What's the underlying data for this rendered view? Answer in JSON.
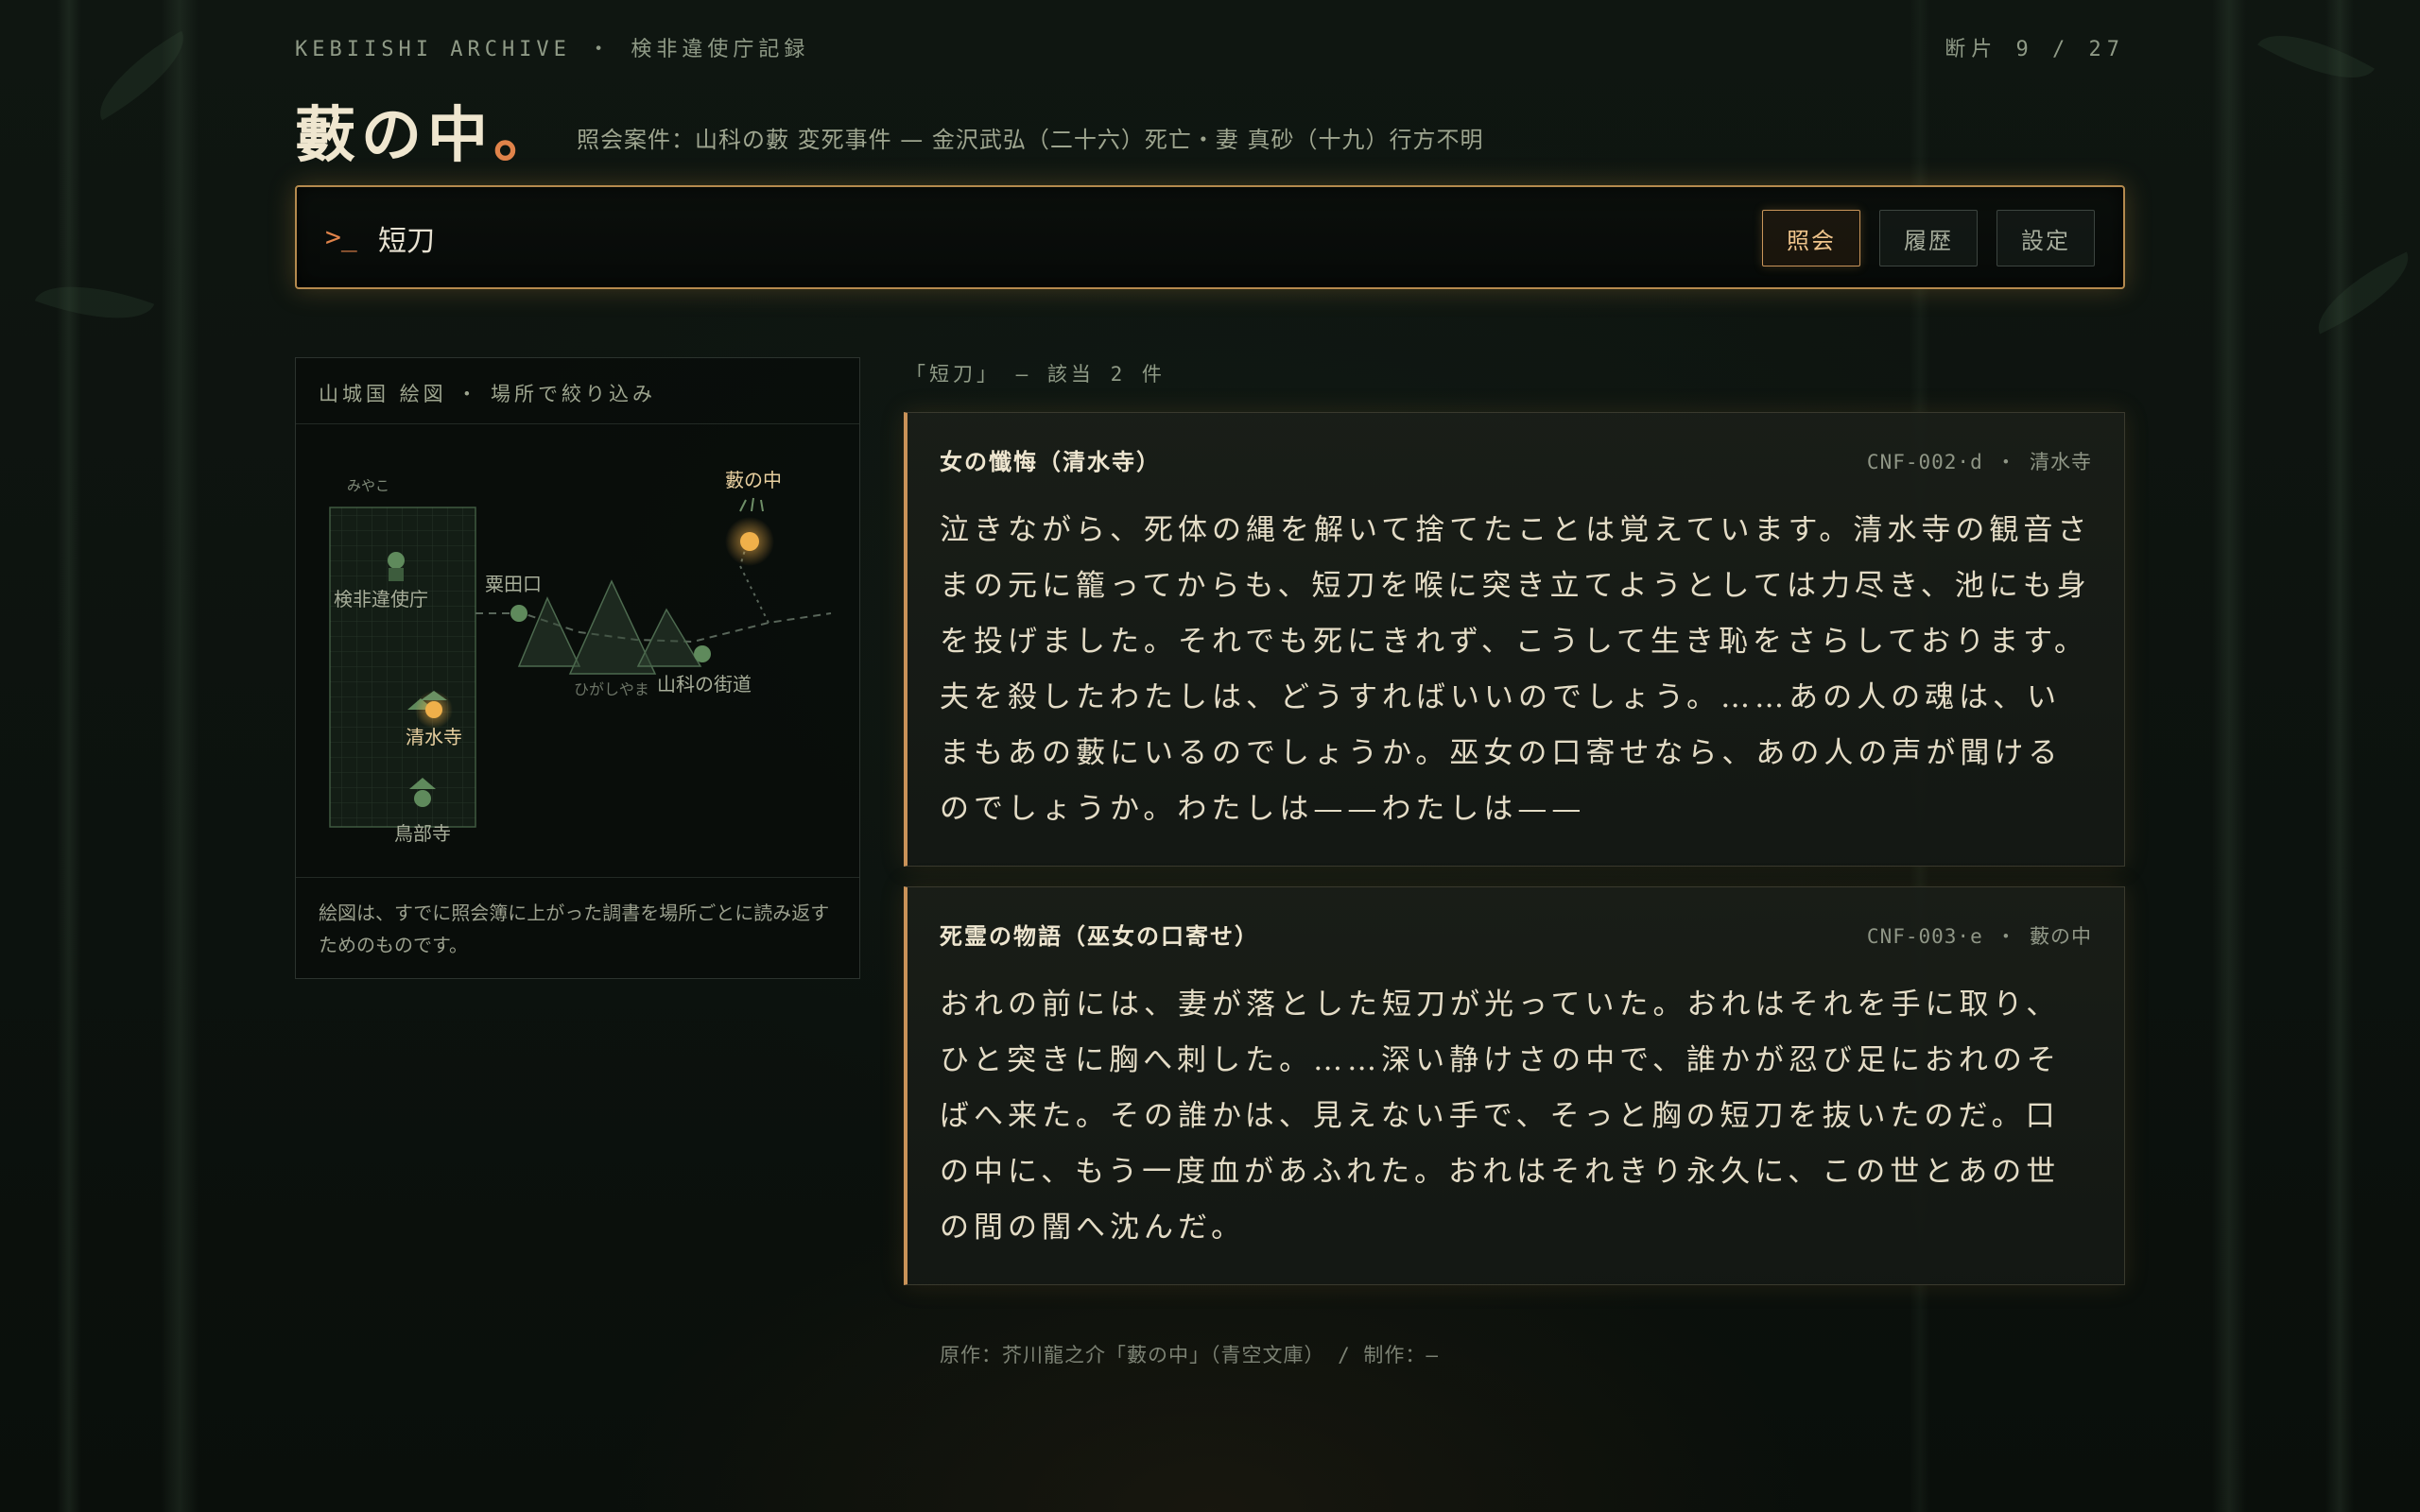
{
  "header": {
    "kicker": "KEBIISHI ARCHIVE ・ 検非違使庁記録",
    "fragment": "断片 9 / 27",
    "title": "藪の中",
    "title_dot": "。",
    "subtitle": "照会案件：山科の藪 変死事件 — 金沢武弘（二十六）死亡・妻 真砂（十九）行方不明"
  },
  "search": {
    "prompt": ">_",
    "value": "短刀",
    "buttons": {
      "query": "照会",
      "history": "履歴",
      "settings": "設定"
    }
  },
  "map": {
    "heading": "山城国 絵図 ・ 場所で絞り込み",
    "labels": {
      "miyako": "みやこ",
      "kebiishi": "検非違使庁",
      "awataguchi": "粟田口",
      "yabu": "藪の中",
      "higashiyama": "ひがしやま",
      "yamashina": "山科の街道",
      "kiyomizu": "清水寺",
      "toribe": "鳥部寺"
    },
    "caption": "絵図は、すでに照会簿に上がった調書を場所ごとに読み返すためのものです。",
    "colors": {
      "active": "#f0b04a",
      "inactive": "#5f8a5c"
    }
  },
  "results": {
    "count_text": "「短刀」 — 該当 2 件",
    "items": [
      {
        "title": "女の懺悔（清水寺）",
        "ref": "CNF-002·d ・ 清水寺",
        "body": "泣きながら、死体の縄を解いて捨てたことは覚えています。清水寺の観音さまの元に籠ってからも、短刀を喉に突き立てようとしては力尽き、池にも身を投げました。それでも死にきれず、こうして生き恥をさらしております。夫を殺したわたしは、どうすればいいのでしょう。……あの人の魂は、いまもあの藪にいるのでしょうか。巫女の口寄せなら、あの人の声が聞けるのでしょうか。わたしは——わたしは——"
      },
      {
        "title": "死霊の物語（巫女の口寄せ）",
        "ref": "CNF-003·e ・ 藪の中",
        "body": "おれの前には、妻が落とした短刀が光っていた。おれはそれを手に取り、ひと突きに胸へ刺した。……深い静けさの中で、誰かが忍び足におれのそばへ来た。その誰かは、見えない手で、そっと胸の短刀を抜いたのだ。口の中に、もう一度血があふれた。おれはそれきり永久に、この世とあの世の間の闇へ沈んだ。"
      }
    ]
  },
  "footer": {
    "credit": "原作：芥川龍之介「藪の中」（青空文庫） / 制作：—"
  }
}
